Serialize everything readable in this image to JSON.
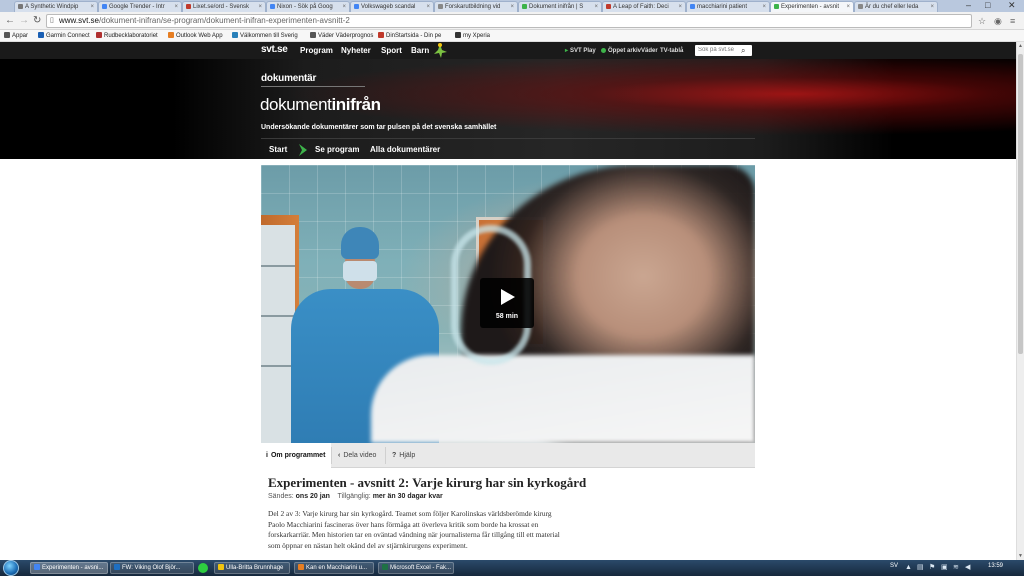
{
  "browser": {
    "tabs": [
      {
        "label": "A Synthetic Windpip",
        "color": "#777777"
      },
      {
        "label": "Google Trender - Intr",
        "color": "#4285f4"
      },
      {
        "label": "Lixet.se/ord - Svensk",
        "color": "#c0392b"
      },
      {
        "label": "Nixon - Sök på Goog",
        "color": "#4285f4"
      },
      {
        "label": "Volkswageb scandal",
        "color": "#4285f4"
      },
      {
        "label": "Forskarutbildning vid",
        "color": "#888888"
      },
      {
        "label": "Dokument inifrån | S",
        "color": "#3db34a"
      },
      {
        "label": "A Leap of Faith: Deci",
        "color": "#c0392b"
      },
      {
        "label": "macchiarini patient",
        "color": "#4285f4"
      },
      {
        "label": "Experimenten - avsnit",
        "color": "#3db34a"
      },
      {
        "label": "Är du chef eller leda",
        "color": "#888888"
      }
    ],
    "active_tab": 9,
    "url_host": "www.svt.se",
    "url_path": "/dokument-inifran/se-program/dokument-inifran-experimenten-avsnitt-2",
    "bookmarks": [
      {
        "label": "Appar",
        "color": "#555555"
      },
      {
        "label": "Garmin Connect",
        "color": "#1a5fb4"
      },
      {
        "label": "Rudbecklaboratoriet",
        "color": "#b03030"
      },
      {
        "label": "Outlook Web App",
        "color": "#e67e22"
      },
      {
        "label": "Välkommen till Sverig",
        "color": "#2980b9"
      },
      {
        "label": "Väder Väderprognos",
        "color": "#555555"
      },
      {
        "label": "DinStartsida - Din pe",
        "color": "#c0392b"
      },
      {
        "label": "my Xperia",
        "color": "#333333"
      }
    ]
  },
  "svt": {
    "logo": "svt.se",
    "nav": [
      "Program",
      "Nyheter",
      "Sport",
      "Barn"
    ],
    "right_links": [
      "SVT Play",
      "Öppet arkiv",
      "Väder",
      "TV-tablå"
    ],
    "search_placeholder": "Sök på svt.se"
  },
  "hero": {
    "kicker": "dokumentär",
    "brand_light": "dokument",
    "brand_bold": "inifrån",
    "tagline": "Undersökande dokumentärer som tar pulsen på det svenska samhället",
    "subnav": [
      "Start",
      "Se program",
      "Alla dokumentärer"
    ]
  },
  "video": {
    "duration": "58 min",
    "tabs": [
      "Om programmet",
      "Dela video",
      "Hjälp"
    ]
  },
  "episode": {
    "title": "Experimenten - avsnitt 2: Varje kirurg har sin kyrkogård",
    "sent_label": "Sändes:",
    "sent_value": "ons 20 jan",
    "avail_label": "Tillgänglig:",
    "avail_value": "mer än 30 dagar kvar",
    "description": "Del 2 av 3: Varje kirurg har sin kyrkogård. Teamet som följer Karolinskas världsberömde kirurg Paolo Macchiarini fascineras över hans förmåga att överleva kritik som borde ha krossat en forskarkarriär. Men historien tar en oväntad vändning när journalisterna får tillgång till ett material som öppnar en nästan helt okänd del av stjärnkirurgens experiment."
  },
  "taskbar": {
    "tasks": [
      {
        "label": "Experimenten - avsni...",
        "color": "#4285f4"
      },
      {
        "label": "FW: Viking Olof Björ...",
        "color": "#1e6fc2"
      },
      {
        "label": "Ulla-Britta Brunnhage",
        "color": "#f1c40f"
      },
      {
        "label": "Kan en Macchiarini u...",
        "color": "#e67e22"
      },
      {
        "label": "Microsoft Excel - Fak...",
        "color": "#1e7145"
      }
    ],
    "lang": "SV",
    "clock": "13:59"
  }
}
